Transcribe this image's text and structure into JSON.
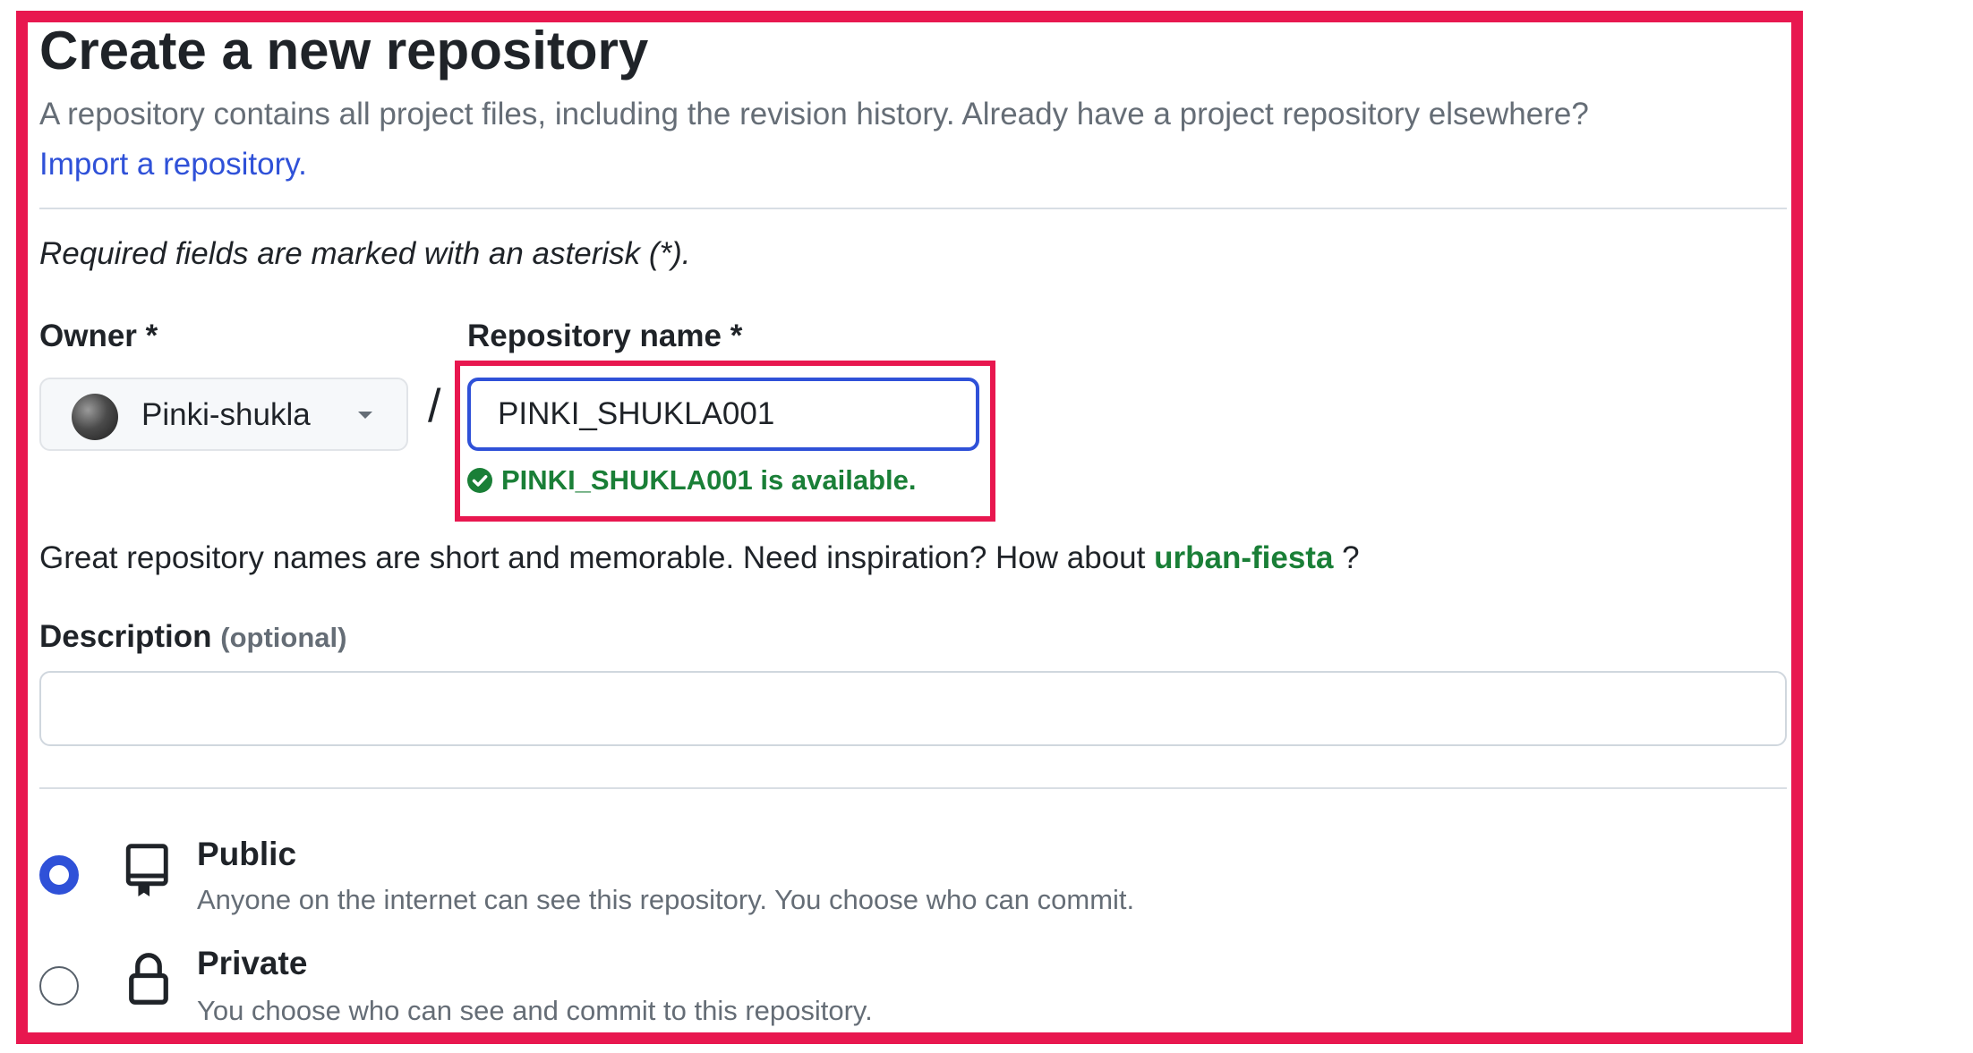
{
  "header": {
    "title": "Create a new repository",
    "subtitle": "A repository contains all project files, including the revision history. Already have a project repository elsewhere?",
    "import_link": "Import a repository."
  },
  "form": {
    "required_note": "Required fields are marked with an asterisk (*).",
    "owner": {
      "label": "Owner *",
      "selected": "Pinki-shukla",
      "icon": "avatar"
    },
    "separator": "/",
    "repo_name": {
      "label": "Repository name *",
      "value": "PINKI_SHUKLA001",
      "availability": "PINKI_SHUKLA001 is available.",
      "availability_icon": "check-circle-icon"
    },
    "inspiration": {
      "prefix": "Great repository names are short and memorable. Need inspiration? How about",
      "suggestion": "urban-fiesta",
      "suffix": "?"
    },
    "description": {
      "label": "Description",
      "optional": "(optional)",
      "value": ""
    },
    "visibility": [
      {
        "title": "Public",
        "description": "Anyone on the internet can see this repository. You choose who can commit.",
        "icon": "repo-icon",
        "checked": true
      },
      {
        "title": "Private",
        "description": "You choose who can see and commit to this repository.",
        "icon": "lock-icon",
        "checked": false
      }
    ]
  },
  "colors": {
    "highlight_border": "#e8174f",
    "link": "#2f51d8",
    "success": "#1a7f37",
    "muted_text": "#656d76"
  }
}
